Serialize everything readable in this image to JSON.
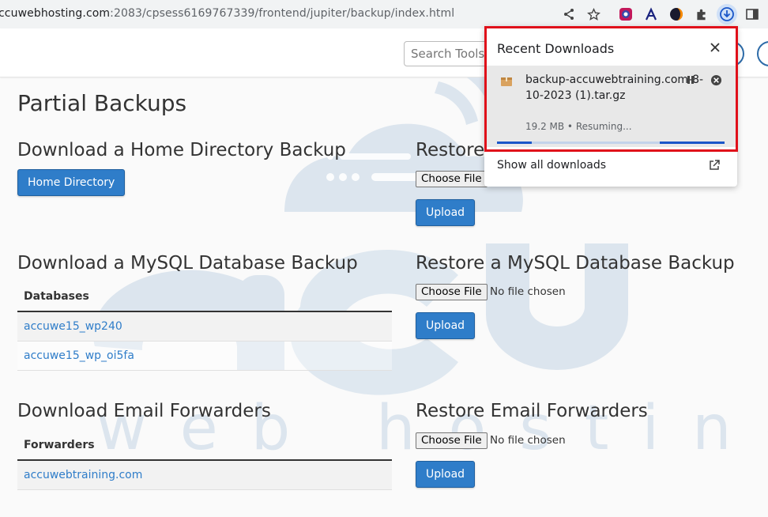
{
  "browser": {
    "url_host": "ccuwebhosting.com",
    "url_path": ":2083/cpsess6169767339/frontend/jupiter/backup/index.html",
    "icons": [
      "share-icon",
      "bookmark-star-icon",
      "extension-color-icon",
      "extension-arrow-icon",
      "extension-moon-icon",
      "puzzle-icon",
      "download-icon",
      "sidebar-icon"
    ]
  },
  "header": {
    "search_placeholder": "Search Tools"
  },
  "watermark": {
    "brand": "accu",
    "tagline": "web hosting"
  },
  "page": {
    "title": "Partial Backups",
    "home_section": {
      "heading": "Download a Home Directory Backup",
      "button": "Home Directory"
    },
    "restore_home": {
      "heading": "Restore",
      "choose": "Choose File",
      "upload": "Upload"
    },
    "mysql_section": {
      "heading": "Download a MySQL Database Backup",
      "column": "Databases",
      "rows": [
        "accuwe15_wp240",
        "accuwe15_wp_oi5fa"
      ]
    },
    "restore_mysql": {
      "heading": "Restore a MySQL Database Backup",
      "choose": "Choose File",
      "status": "No file chosen",
      "upload": "Upload"
    },
    "email_section": {
      "heading": "Download Email Forwarders",
      "column": "Forwarders",
      "rows": [
        "accuwebtraining.com"
      ]
    },
    "restore_email": {
      "heading": "Restore Email Forwarders",
      "choose": "Choose File",
      "status": "No file chosen",
      "upload": "Upload"
    }
  },
  "downloads": {
    "title": "Recent Downloads",
    "file_name": "backup-accuwebtraining.com-8-10-2023 (1).tar.gz",
    "status": "19.2 MB • Resuming...",
    "show_all": "Show all downloads"
  },
  "colors": {
    "accent": "#2f7dc9",
    "highlight": "#e0101a",
    "progress": "#1a56c8"
  }
}
